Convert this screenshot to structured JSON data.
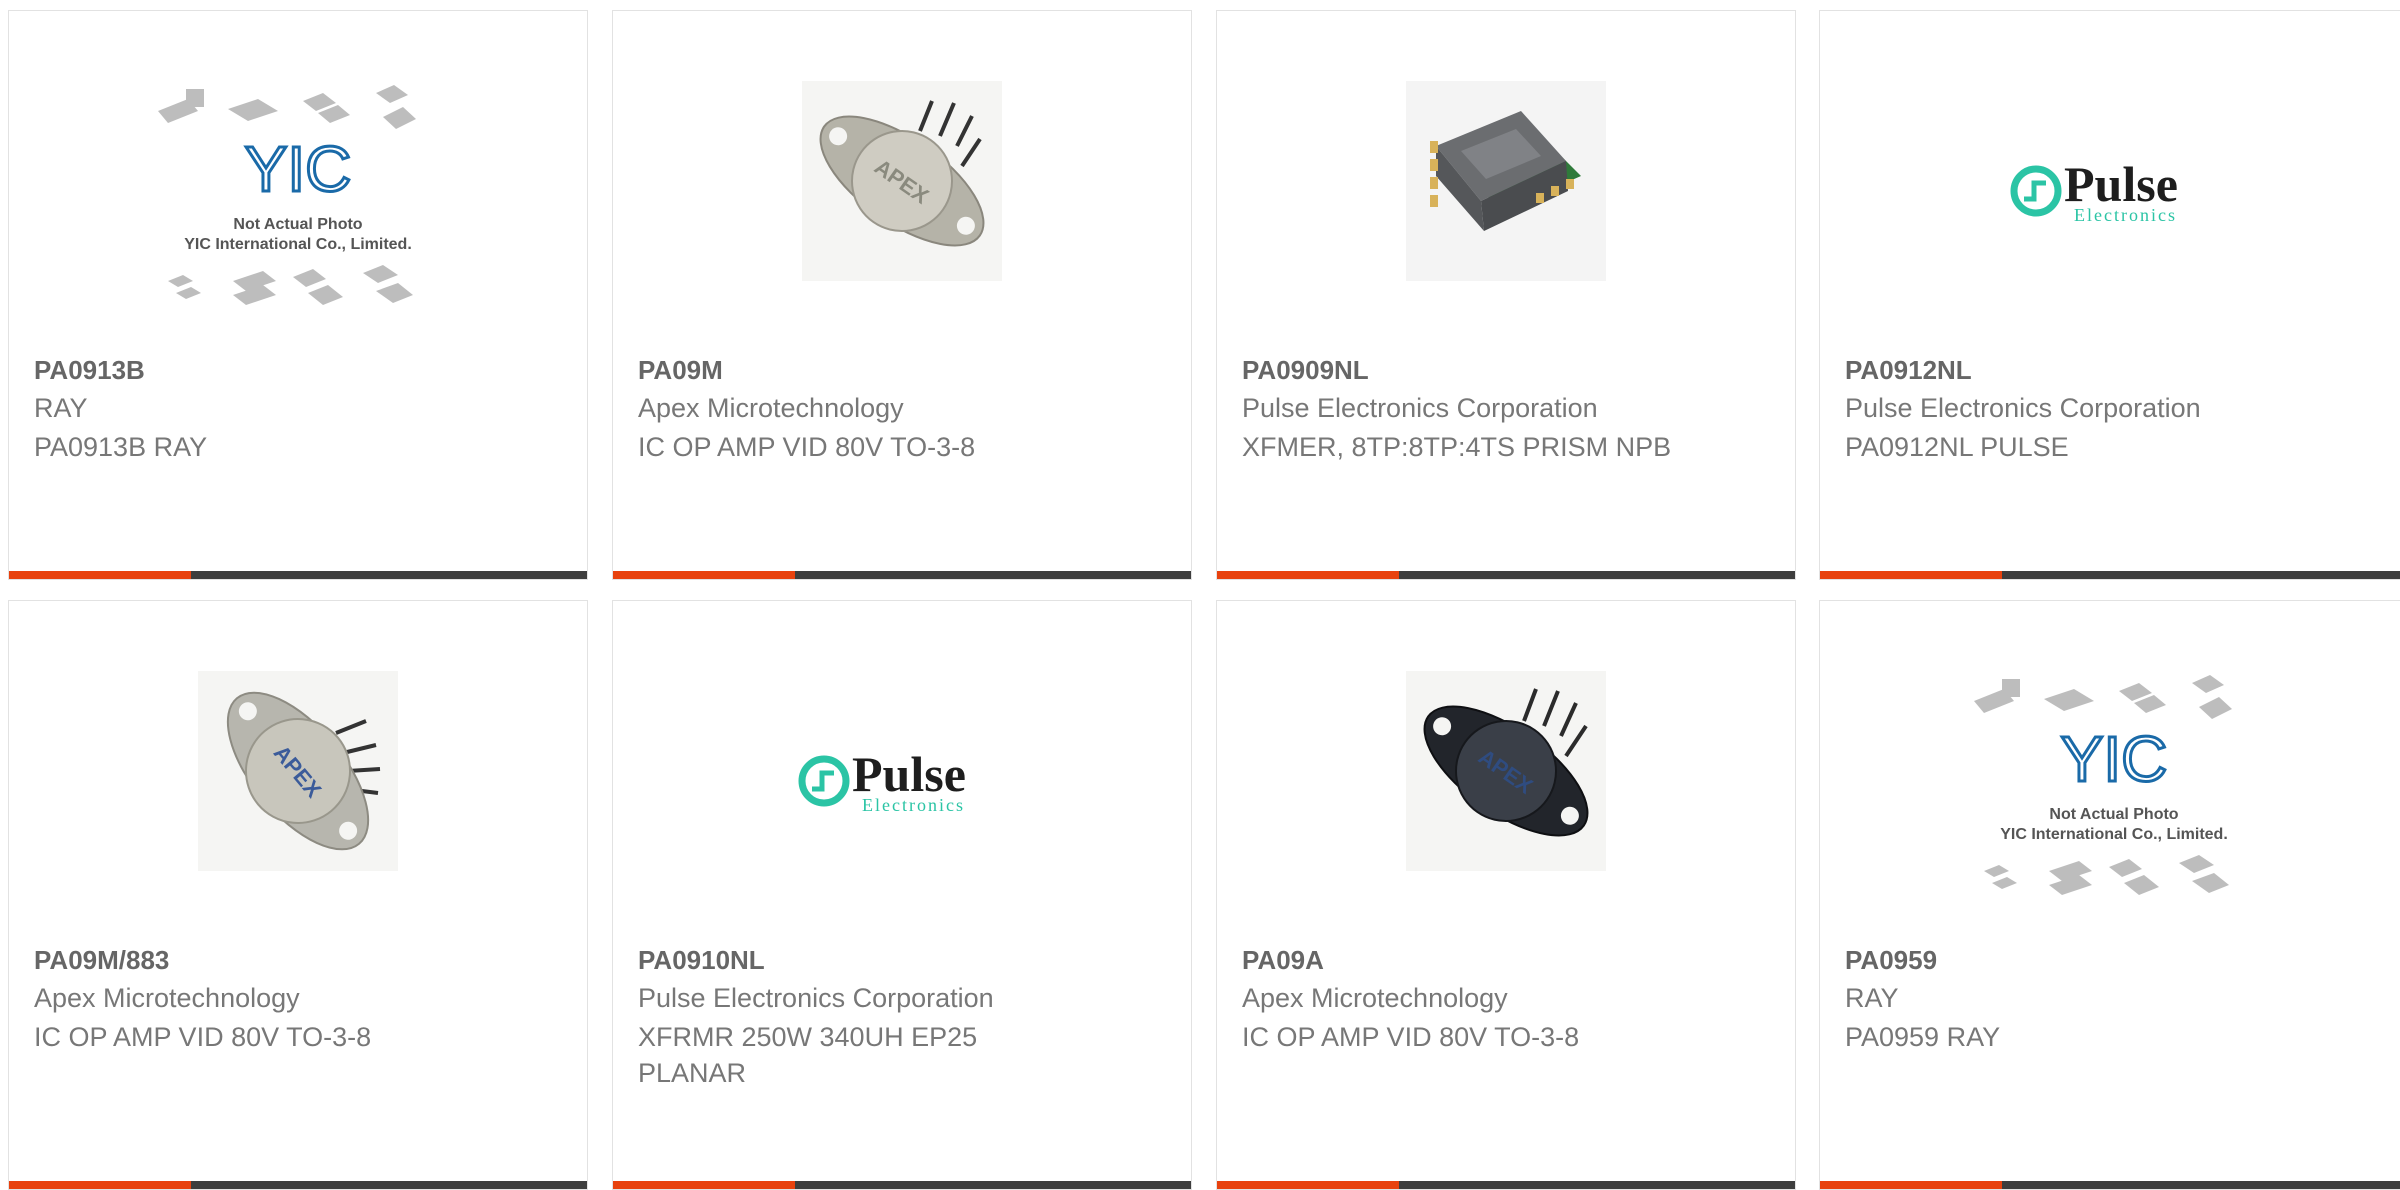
{
  "products": [
    {
      "part": "PA0913B",
      "manufacturer": "RAY",
      "description": "PA0913B RAY",
      "image": "yic-placeholder",
      "placeholder_lines": [
        "Not Actual Photo",
        "YIC International Co., Limited."
      ],
      "logo_text": "YIC"
    },
    {
      "part": "PA09M",
      "manufacturer": "Apex Microtechnology",
      "description": "IC OP AMP VID 80V TO-3-8",
      "image": "to3-package-silver",
      "logo_text": "APEX"
    },
    {
      "part": "PA0909NL",
      "manufacturer": "Pulse Electronics Corporation",
      "description": "XFMER, 8TP:8TP:4TS PRISM NPB",
      "image": "smd-transformer"
    },
    {
      "part": "PA0912NL",
      "manufacturer": "Pulse Electronics Corporation",
      "description": "PA0912NL PULSE",
      "image": "pulse-logo",
      "logo_text": "Pulse",
      "logo_sub": "Electronics"
    },
    {
      "part": "PA09M/883",
      "manufacturer": "Apex Microtechnology",
      "description": "IC OP AMP VID 80V TO-3-8",
      "image": "to3-package-silver",
      "logo_text": "APEX"
    },
    {
      "part": "PA0910NL",
      "manufacturer": "Pulse Electronics Corporation",
      "description": "XFRMR 250W 340UH EP25 PLANAR",
      "image": "pulse-logo",
      "logo_text": "Pulse",
      "logo_sub": "Electronics"
    },
    {
      "part": "PA09A",
      "manufacturer": "Apex Microtechnology",
      "description": "IC OP AMP VID 80V TO-3-8",
      "image": "to3-package-dark",
      "logo_text": "APEX"
    },
    {
      "part": "PA0959",
      "manufacturer": "RAY",
      "description": "PA0959 RAY",
      "image": "yic-placeholder",
      "placeholder_lines": [
        "Not Actual Photo",
        "YIC International Co., Limited."
      ],
      "logo_text": "YIC"
    }
  ],
  "colors": {
    "accent": "#e8420e",
    "bar": "#3d3d3d",
    "pulse": "#2bc4a5",
    "yic": "#1a6aa8"
  }
}
